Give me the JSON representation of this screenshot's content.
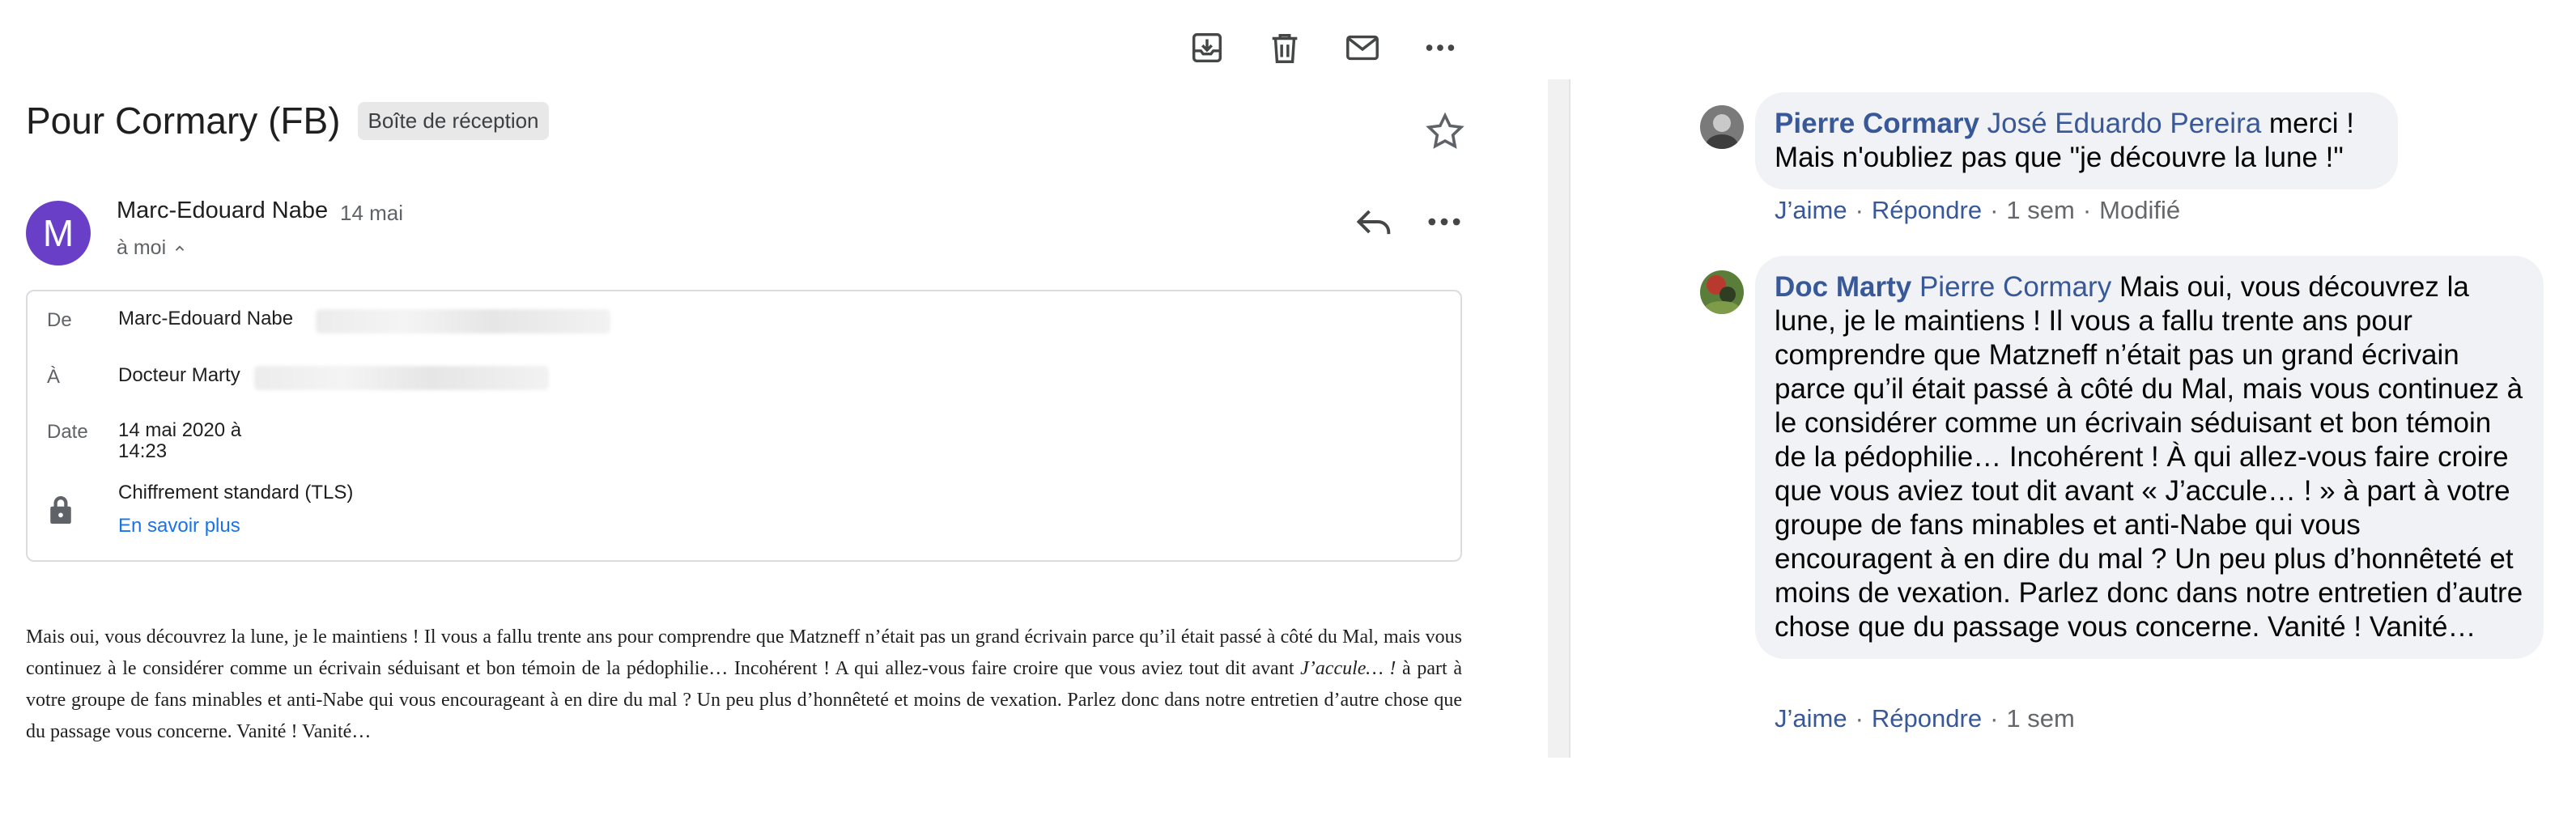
{
  "toolbar": {
    "icons": [
      "archive-icon",
      "delete-icon",
      "mark-unread-icon",
      "more-icon"
    ]
  },
  "email": {
    "subject": "Pour Cormary (FB)",
    "label": "Boîte de réception",
    "sender_initial": "M",
    "sender_name": "Marc-Edouard Nabe",
    "date_short": "14 mai",
    "to_me": "à moi",
    "details": {
      "from_label": "De",
      "from_value": "Marc-Edouard Nabe",
      "to_label": "À",
      "to_value": "Docteur Marty",
      "date_label": "Date",
      "date_value_line1": "14 mai 2020 à",
      "date_value_line2": "14:23",
      "security_value": "Chiffrement standard (TLS)",
      "learn_more": "En savoir plus"
    },
    "body_part1": "Mais oui, vous découvrez la lune, je le maintiens !  Il vous a fallu trente ans pour comprendre que Matzneff n’était pas un grand écrivain parce qu’il était passé à côté du Mal, mais vous continuez à le considérer comme un écrivain séduisant et bon témoin de la pédophilie… Incohérent ! A qui allez-vous faire croire que vous aviez tout dit avant ",
    "body_italic": "J’accule… !",
    "body_part2": " à part à votre groupe de fans minables et anti-Nabe qui vous encourageant à en dire du mal ? Un peu plus d’honnêteté et moins de vexation. Parlez donc dans notre entretien d’autre chose que du passage vous concerne. Vanité ! Vanité…"
  },
  "comments": [
    {
      "author": "Pierre Cormary",
      "tag": "José Eduardo Pereira",
      "text": " merci ! Mais n'oubliez pas que \"je découvre la lune !\"",
      "like": "J’aime",
      "reply": "Répondre",
      "time": "1 sem",
      "edited": "Modifié"
    },
    {
      "author": "Doc Marty",
      "tag": "Pierre Cormary",
      "text": " Mais oui, vous découvrez la lune, je le maintiens ! Il vous a fallu trente ans pour comprendre que Matzneff n’était pas un grand écrivain parce qu’il était passé à côté du Mal, mais vous continuez à le considérer comme un écrivain séduisant et bon témoin de la pédophilie… Incohérent ! À qui allez-vous faire croire que vous aviez tout dit avant « J’accule… ! » à part à votre groupe de fans minables et anti-Nabe qui vous encouragent à en dire du mal ? Un peu plus d’honnêteté et moins de vexation. Parlez donc dans notre entretien d’autre chose que du passage vous concerne. Vanité ! Vanité…",
      "like": "J’aime",
      "reply": "Répondre",
      "time": "1 sem"
    }
  ],
  "colors": {
    "avatar": "#6a3fc7",
    "link_blue": "#1a73e8",
    "fb_name": "#385898",
    "bubble_bg": "#f0f2f5"
  }
}
